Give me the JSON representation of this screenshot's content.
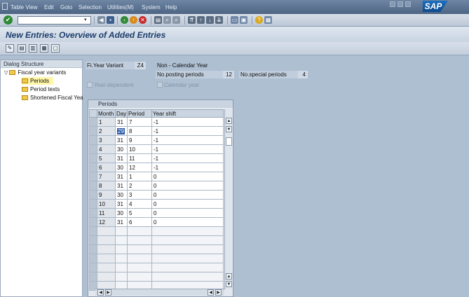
{
  "menubar": {
    "items": [
      "Table View",
      "Edit",
      "Goto",
      "Selection",
      "Utilities(M)",
      "System",
      "Help"
    ],
    "logo": "SAP"
  },
  "stdbar": {
    "command_field": ""
  },
  "title": "New Entries: Overview of Added Entries",
  "dialog_structure": {
    "header": "Dialog Structure",
    "items": [
      {
        "label": "Fiscal year variants",
        "level": 0,
        "expanded": true
      },
      {
        "label": "Periods",
        "level": 1,
        "selected": true
      },
      {
        "label": "Period texts",
        "level": 1
      },
      {
        "label": "Shortened Fiscal Yea",
        "level": 1
      }
    ]
  },
  "header_fields": {
    "fy_variant_label": "Fi.Year Variant",
    "fy_variant_value": "Z4",
    "calendar_type": "Non - Calendar Year",
    "posting_periods_label": "No.posting periods",
    "posting_periods_value": "12",
    "special_periods_label": "No.special periods",
    "special_periods_value": "4",
    "year_dependent_label": "Year-dependent",
    "calendar_year_label": "Calendar year"
  },
  "periods_table": {
    "title": "Periods",
    "columns": [
      "Month",
      "Day",
      "Period",
      "Year shift"
    ],
    "rows": [
      [
        "1",
        "31",
        "7",
        "-1"
      ],
      [
        "2",
        "29",
        "8",
        "-1"
      ],
      [
        "3",
        "31",
        "9",
        "-1"
      ],
      [
        "4",
        "30",
        "10",
        "-1"
      ],
      [
        "5",
        "31",
        "11",
        "-1"
      ],
      [
        "6",
        "30",
        "12",
        "-1"
      ],
      [
        "7",
        "31",
        "1",
        "0"
      ],
      [
        "8",
        "31",
        "2",
        "0"
      ],
      [
        "9",
        "30",
        "3",
        "0"
      ],
      [
        "10",
        "31",
        "4",
        "0"
      ],
      [
        "11",
        "30",
        "5",
        "0"
      ],
      [
        "12",
        "31",
        "6",
        "0"
      ]
    ],
    "empty_rows": 7
  },
  "colors": {
    "background": "#aebfd2",
    "menubar": "#4d6583",
    "title_text": "#1c3d6c",
    "tree_selected": "#fff7a8"
  }
}
